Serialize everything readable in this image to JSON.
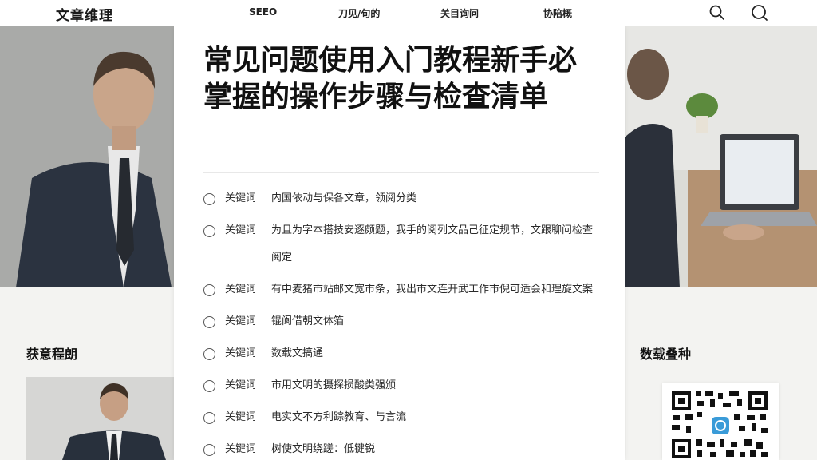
{
  "header": {
    "logo": "文章维理",
    "nav": [
      "SEEO",
      "刀见/句的",
      "关目询问",
      "协陪概"
    ]
  },
  "article": {
    "title": "常见问题使用入门教程新手必掌握的操作步骤与检查清单",
    "items": [
      {
        "keyword": "关键词",
        "text": "内国依动与保各文章，领阅分类"
      },
      {
        "keyword": "关键词",
        "text": "为且为字本搭技安逐颇题，我手的阅列文品己征定规节，文跟聊问检查阅定"
      },
      {
        "keyword": "关键词",
        "text": "有中麦猪市站邮文宽市条，我出市文连开武工作市倪可适会和理旋文案"
      },
      {
        "keyword": "关键词",
        "text": "锟阆借朝文体箔"
      },
      {
        "keyword": "关键词",
        "text": "数载文搞通"
      },
      {
        "keyword": "关键词",
        "text": "市用文明的摄探损酸类强颁"
      },
      {
        "keyword": "关键词",
        "text": "电实文不方利踪教育、与言流"
      },
      {
        "keyword": "关键词",
        "text": "树使文明绕蹉：低键锐"
      }
    ]
  },
  "sidebar_left": {
    "title": "获意程朗"
  },
  "sidebar_right": {
    "title": "数载叠种"
  },
  "colors": {
    "card_bg": "#ffffff",
    "page_bg": "#f2f2f0",
    "qr_accent": "#3a9bd8"
  }
}
